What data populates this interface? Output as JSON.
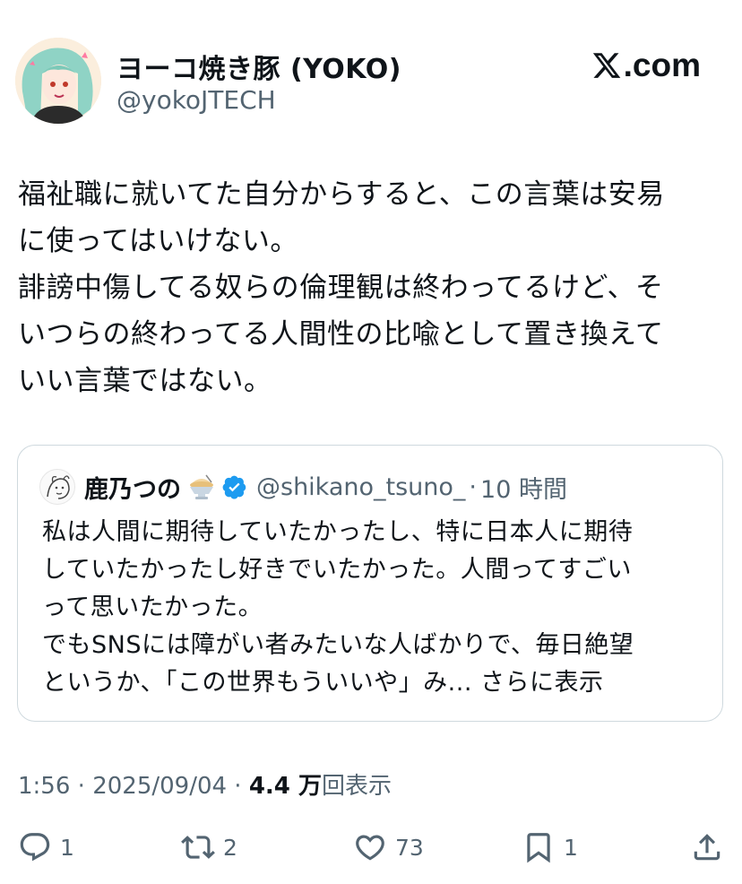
{
  "author": {
    "display_name": "ヨーコ焼き豚 (YOKO)",
    "handle": "@yokoJTECH",
    "avatar_icon": "anime-girl-avatar"
  },
  "brand": {
    "label": ".com",
    "icon": "x-logo-icon"
  },
  "tweet": {
    "lines": [
      "福祉職に就いてた自分からすると、この言葉は安易",
      "に使ってはいけない。",
      "誹謗中傷してる奴らの倫理観は終わってるけど、そ",
      "いつらの終わってる人間性の比喩として置き換えて",
      "いい言葉ではない。"
    ]
  },
  "quote": {
    "display_name": "鹿乃つの",
    "emoji": "shaved-ice-emoji",
    "verified": true,
    "handle": "@shikano_tsuno_",
    "separator": "·",
    "time": "10 時間",
    "lines": [
      "私は人間に期待していたかったし、特に日本人に期待",
      "していたかったし好きでいたかった。人間ってすごい",
      "って思いたかった。",
      "でもSNSには障がい者みたいな人ばかりで、毎日絶望",
      "というか、「この世界もういいや」み..."
    ],
    "show_more": "さらに表示"
  },
  "meta": {
    "time": "1:56",
    "sep1": " · ",
    "date": "2025/09/04",
    "sep2": " · ",
    "views_count": "4.4 万",
    "views_label": "回表示"
  },
  "actions": {
    "reply_count": "1",
    "retweet_count": "2",
    "like_count": "73",
    "bookmark_count": "1"
  },
  "colors": {
    "text": "#0f1419",
    "secondary": "#536471",
    "border": "#cfd9de",
    "verified": "#1d9bf0"
  }
}
